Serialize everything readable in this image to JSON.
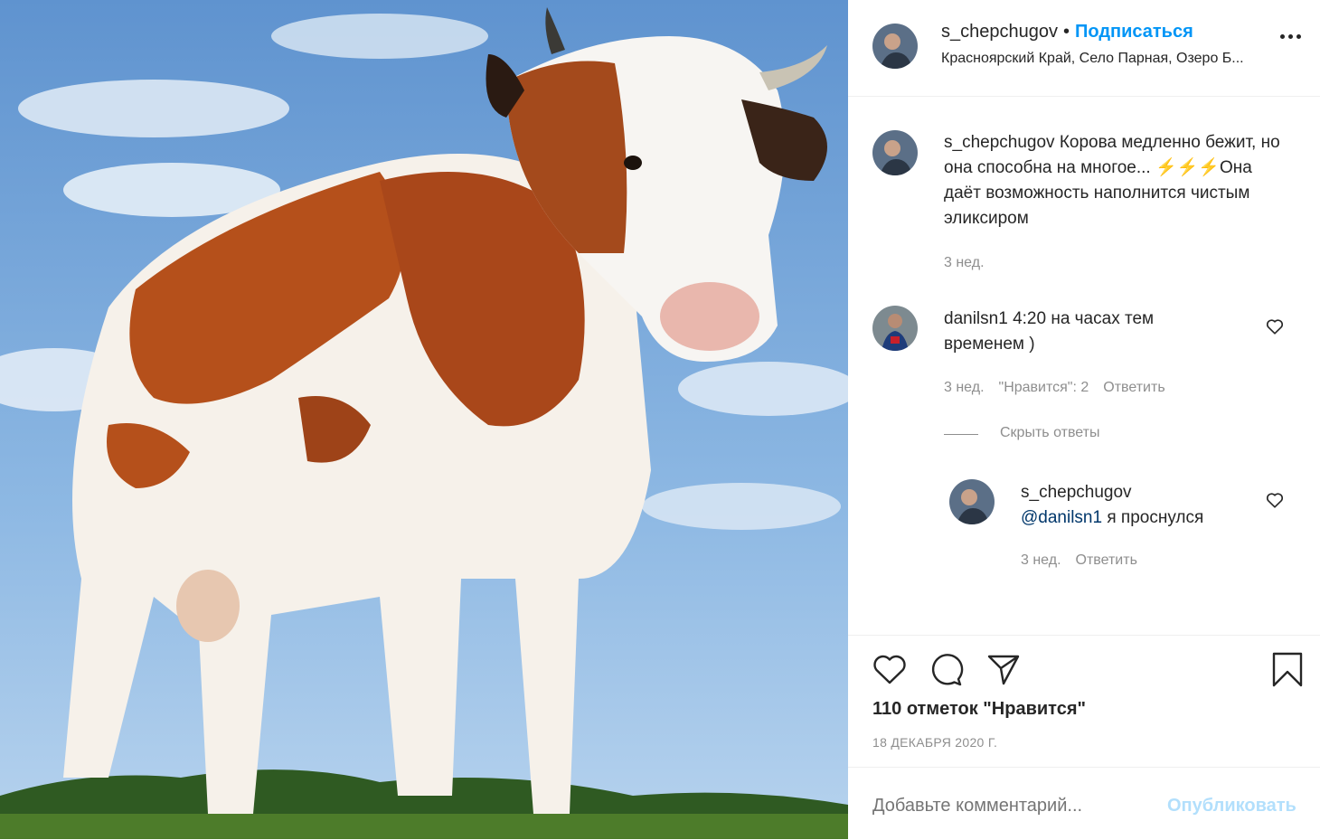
{
  "post": {
    "username": "s_chepchugov",
    "separator": "•",
    "follow_label": "Подписаться",
    "location": "Красноярский Край, Село Парная, Озеро Б..."
  },
  "caption": {
    "username": "s_chepchugov",
    "text": "Корова медленно бежит, но она способна на многое... ⚡⚡⚡Она даёт возможность наполнится чистым эликсиром",
    "time": "3 нед."
  },
  "comments": [
    {
      "username": "danilsn1",
      "text": "4:20 на часах тем временем )",
      "time": "3 нед.",
      "likes": "\"Нравится\": 2",
      "reply_label": "Ответить"
    }
  ],
  "hide_replies_label": "Скрыть ответы",
  "replies": [
    {
      "username": "s_chepchugov",
      "mention": "@danilsn1",
      "text": "я проснулся",
      "time": "3 нед.",
      "reply_label": "Ответить"
    }
  ],
  "stats": {
    "likes_text": "110 отметок \"Нравится\"",
    "date": "18 ДЕКАБРЯ 2020 Г."
  },
  "add_comment": {
    "placeholder": "Добавьте комментарий...",
    "post_label": "Опубликовать"
  },
  "colors": {
    "accent": "#0095f6",
    "text": "#262626",
    "muted": "#8e8e8e",
    "disabled_post": "#b2dffc"
  }
}
